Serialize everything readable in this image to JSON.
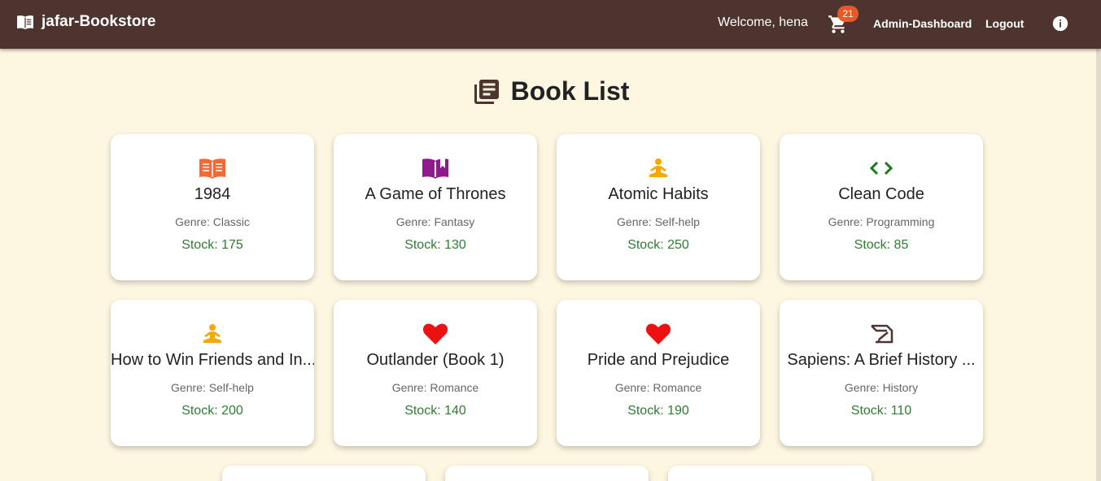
{
  "navbar": {
    "brand": "jafar-Bookstore",
    "welcome": "Welcome, hena",
    "cart_count": "21",
    "admin_link": "Admin-Dashboard",
    "logout_link": "Logout"
  },
  "page": {
    "title": "Book List"
  },
  "books": [
    {
      "title": "1984",
      "genre": "Genre: Classic",
      "stock": "Stock: 175",
      "icon": "open-book-icon",
      "icon_color": "#ef6c3a"
    },
    {
      "title": "A Game of Thrones",
      "genre": "Genre: Fantasy",
      "stock": "Stock: 130",
      "icon": "book-icon",
      "icon_color": "#8e1a8e"
    },
    {
      "title": "Atomic Habits",
      "genre": "Genre: Self-help",
      "stock": "Stock: 250",
      "icon": "meditation-icon",
      "icon_color": "#f5a800"
    },
    {
      "title": "Clean Code",
      "genre": "Genre: Programming",
      "stock": "Stock: 85",
      "icon": "code-icon",
      "icon_color": "#1a7a1a"
    },
    {
      "title": "How to Win Friends and In...",
      "genre": "Genre: Self-help",
      "stock": "Stock: 200",
      "icon": "meditation-icon",
      "icon_color": "#f5a800"
    },
    {
      "title": "Outlander (Book 1)",
      "genre": "Genre: Romance",
      "stock": "Stock: 140",
      "icon": "heart-icon",
      "icon_color": "#ee1111"
    },
    {
      "title": "Pride and Prejudice",
      "genre": "Genre: Romance",
      "stock": "Stock: 190",
      "icon": "heart-icon",
      "icon_color": "#ee1111"
    },
    {
      "title": "Sapiens: A Brief History ...",
      "genre": "Genre: History",
      "stock": "Stock: 110",
      "icon": "history-edu-icon",
      "icon_color": "#4e342e"
    }
  ],
  "colors": {
    "navbar": "#4e342e",
    "background": "#fdf6e0",
    "stock": "#2e7d32",
    "badge": "#e8592a"
  }
}
